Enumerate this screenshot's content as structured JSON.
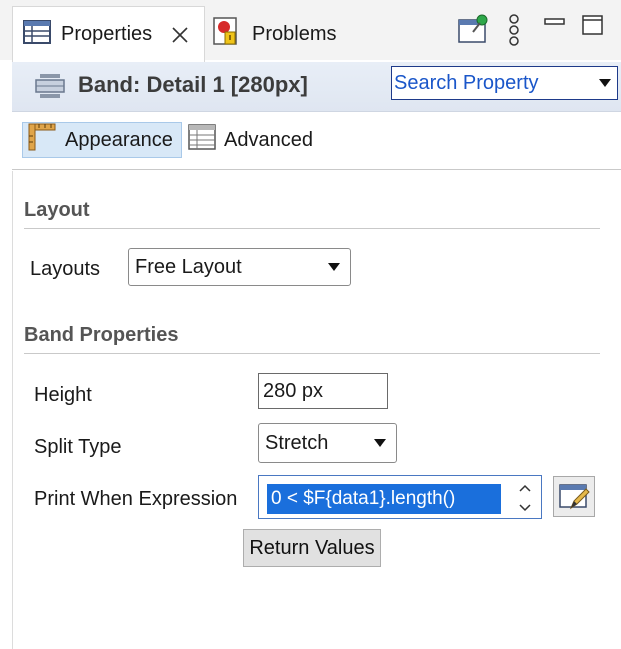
{
  "tabs": [
    {
      "label": "Properties",
      "active": true,
      "icon": "properties-table-icon"
    },
    {
      "label": "Problems",
      "active": false,
      "icon": "problems-icon"
    }
  ],
  "toolbar_icons": [
    "pin-view-icon",
    "view-menu-icon",
    "minimize-icon",
    "maximize-icon"
  ],
  "header": {
    "title": "Band: Detail 1 [280px]",
    "icon": "band-icon",
    "search": {
      "value": "Search Property",
      "placeholder": "Search Property"
    }
  },
  "subtabs": [
    {
      "label": "Appearance",
      "active": true,
      "icon": "ruler-icon"
    },
    {
      "label": "Advanced",
      "active": false,
      "icon": "table-icon"
    }
  ],
  "layout_section": {
    "title": "Layout",
    "layouts_label": "Layouts",
    "layouts_value": "Free Layout"
  },
  "band_section": {
    "title": "Band Properties",
    "height_label": "Height",
    "height_value": "280 px",
    "split_label": "Split Type",
    "split_value": "Stretch",
    "print_label": "Print When Expression",
    "print_value": "0 < $F{data1}.length()",
    "return_button": "Return Values"
  },
  "colors": {
    "accent": "#1a6fdc",
    "header_bg": "#e4ebf5",
    "subtab_active_bg": "#d8e8f7"
  }
}
